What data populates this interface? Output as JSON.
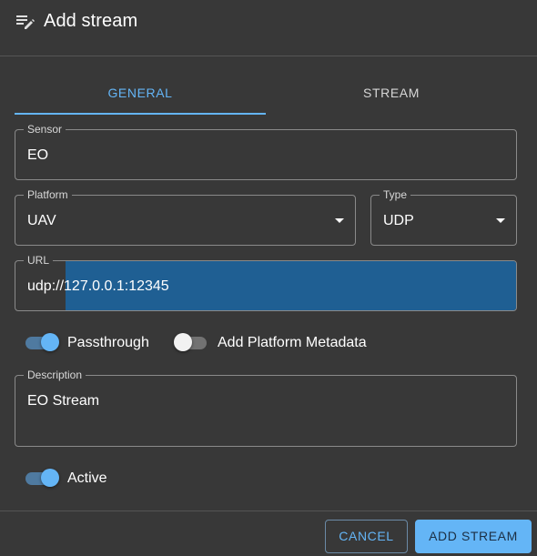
{
  "header": {
    "title": "Add stream",
    "icon": "playlist-edit-icon"
  },
  "tabs": [
    {
      "label": "GENERAL",
      "selected": true
    },
    {
      "label": "STREAM",
      "selected": false
    }
  ],
  "form": {
    "sensor": {
      "label": "Sensor",
      "value": "EO"
    },
    "platform": {
      "label": "Platform",
      "value": "UAV"
    },
    "type": {
      "label": "Type",
      "value": "UDP"
    },
    "url": {
      "label": "URL",
      "value_prefix": "udp://",
      "value_selected": "127.0.0.1:12345"
    },
    "passthrough": {
      "label": "Passthrough",
      "checked": true
    },
    "add_platform_metadata": {
      "label": "Add Platform Metadata",
      "checked": false
    },
    "description": {
      "label": "Description",
      "value": "EO Stream"
    },
    "active": {
      "label": "Active",
      "checked": true
    }
  },
  "footer": {
    "cancel_label": "CANCEL",
    "add_label": "ADD STREAM"
  },
  "colors": {
    "background": "#383838",
    "accent": "#64b5f6",
    "selection": "#1f5f93"
  }
}
